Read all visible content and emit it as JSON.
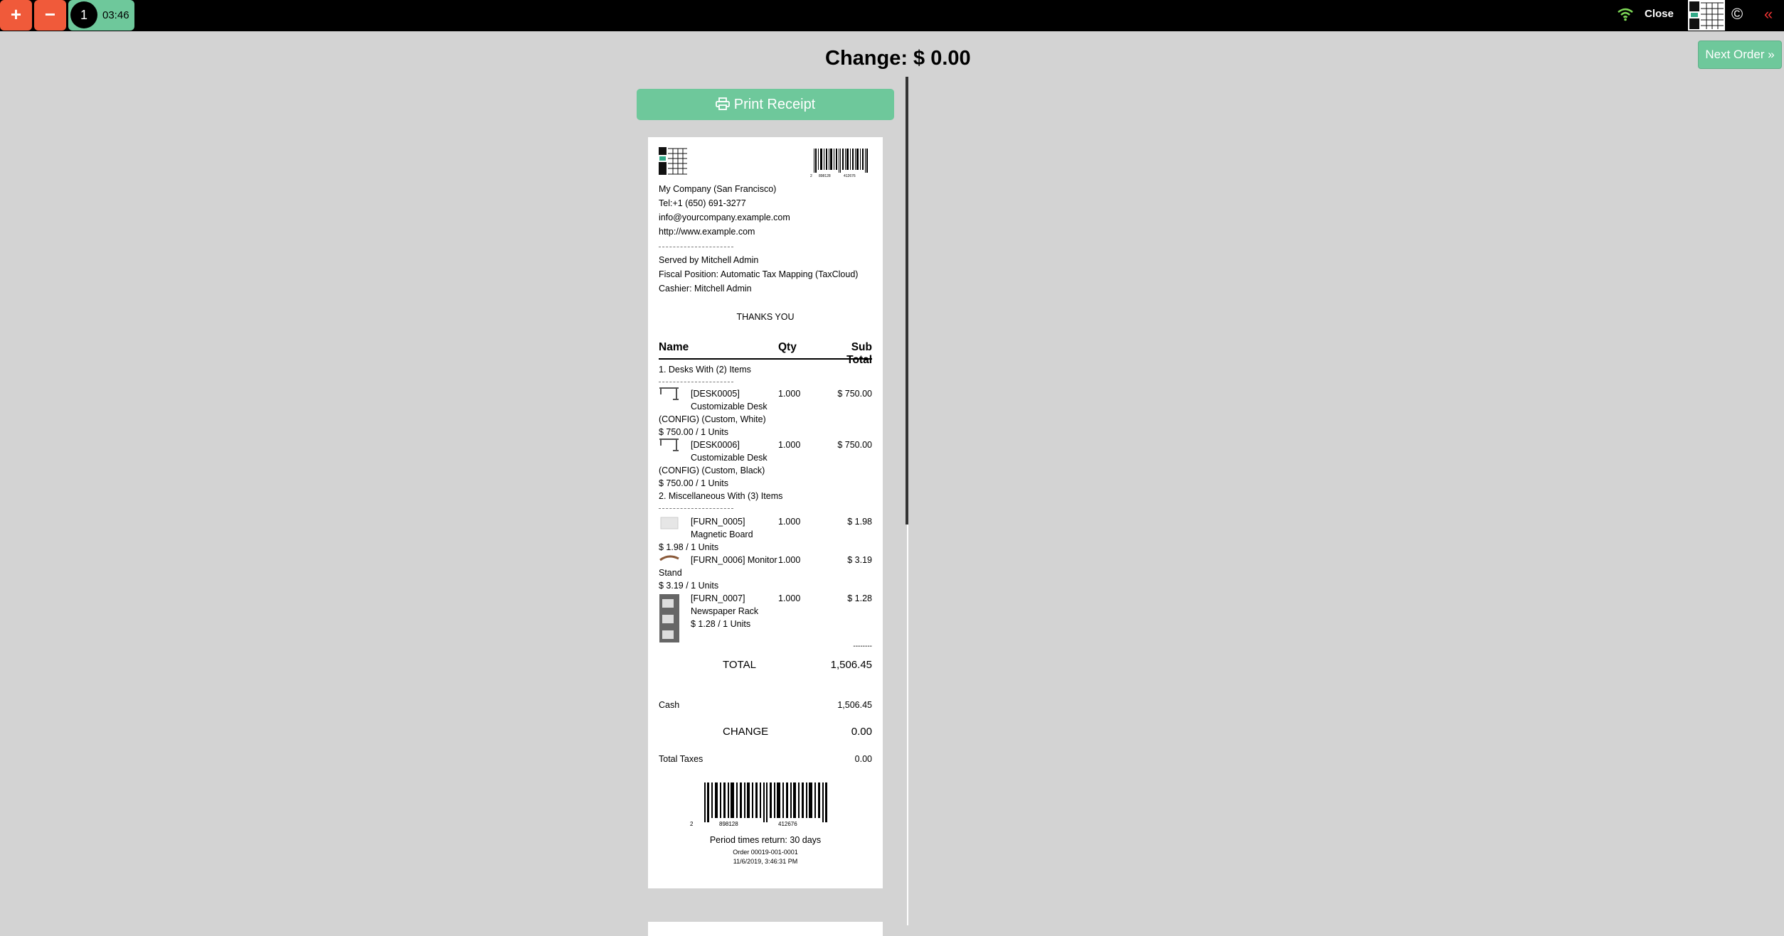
{
  "topbar": {
    "plus_label": "+",
    "minus_label": "−",
    "order_number": "1",
    "order_time": "03:46",
    "close_label": "Close",
    "copyright_symbol": "©",
    "collapse_symbol": "«",
    "icons": [
      "wifi-icon",
      "company-logo",
      "copyright-icon",
      "collapse-icon"
    ]
  },
  "main": {
    "change_title": "Change: $ 0.00",
    "next_order_label": "Next Order »",
    "print_receipt_label": "Print Receipt"
  },
  "receipt": {
    "company": "My Company (San Francisco)",
    "tel": "Tel:+1 (650) 691-3277",
    "email": "info@yourcompany.example.com",
    "website": "http://www.example.com",
    "served_by": "Served by Mitchell Admin",
    "fiscal_position": "Fiscal Position: Automatic Tax Mapping (TaxCloud)",
    "cashier": "Cashier: Mitchell Admin",
    "thanks": "THANKS YOU",
    "headers": {
      "name": "Name",
      "qty": "Qty",
      "subtotal": "Sub Total"
    },
    "group1": "1. Desks With (2) Items",
    "group2": "2. Miscellaneous With (3) Items",
    "lines": [
      {
        "name1": "[DESK0005]",
        "name2": "Customizable Desk",
        "name3": "(CONFIG) (Custom, White)",
        "unit": "$ 750.00 / 1 Units",
        "qty": "1.000",
        "subtotal": "$ 750.00"
      },
      {
        "name1": "[DESK0006]",
        "name2": "Customizable Desk",
        "name3": "(CONFIG) (Custom, Black)",
        "unit": "$ 750.00 / 1 Units",
        "qty": "1.000",
        "subtotal": "$ 750.00"
      },
      {
        "name1": "[FURN_0005]",
        "name2": "Magnetic Board",
        "unit": "$ 1.98 / 1 Units",
        "qty": "1.000",
        "subtotal": "$ 1.98"
      },
      {
        "name1": "[FURN_0006] Monitor",
        "name2": "Stand",
        "unit": "$ 3.19 / 1 Units",
        "qty": "1.000",
        "subtotal": "$ 3.19"
      },
      {
        "name1": "[FURN_0007]",
        "name2": "Newspaper Rack",
        "unit": "$ 1.28 / 1 Units",
        "qty": "1.000",
        "subtotal": "$ 1.28"
      }
    ],
    "total_sep": "--------",
    "total_label": "TOTAL",
    "total_value": "1,506.45",
    "cash_label": "Cash",
    "cash_value": "1,506.45",
    "change_label": "CHANGE",
    "change_value": "0.00",
    "taxes_label": "Total Taxes",
    "taxes_value": "0.00",
    "barcode_left_digit": "2",
    "barcode_group1": "898128",
    "barcode_group2": "412676",
    "return_period": "Period times return: 30 days",
    "order_ref": "Order 00019-001-0001",
    "order_datetime": "11/6/2019, 3:46:31 PM"
  }
}
